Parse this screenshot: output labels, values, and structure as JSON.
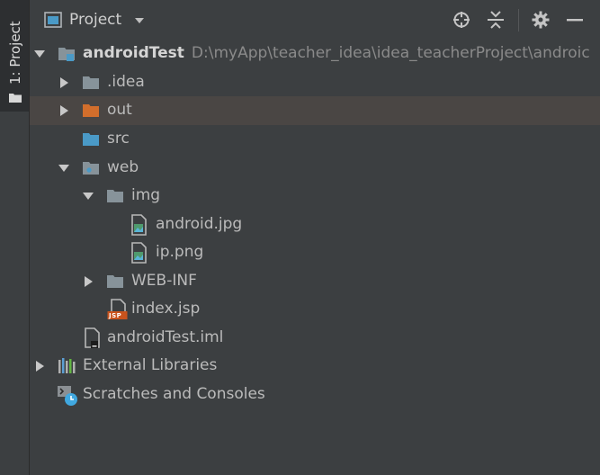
{
  "sidebar": {
    "tab_label": "1: Project"
  },
  "header": {
    "title": "Project",
    "buttons": [
      "locate-icon",
      "collapse-all-icon",
      "gear-icon",
      "minimize-icon"
    ]
  },
  "tree": {
    "root": {
      "name": "androidTest",
      "path": "D:\\myApp\\teacher_idea\\idea_teacherProject\\androic"
    },
    "items": [
      {
        "label": ".idea",
        "type": "folder",
        "expanded": false
      },
      {
        "label": "out",
        "type": "excluded-folder",
        "expanded": false,
        "selected": true
      },
      {
        "label": "src",
        "type": "source-folder"
      },
      {
        "label": "web",
        "type": "web-folder",
        "expanded": true
      },
      {
        "label": "img",
        "type": "folder",
        "expanded": true
      },
      {
        "label": "android.jpg",
        "type": "image-file"
      },
      {
        "label": "ip.png",
        "type": "image-file"
      },
      {
        "label": "WEB-INF",
        "type": "folder",
        "expanded": false
      },
      {
        "label": "index.jsp",
        "type": "jsp-file",
        "badge": "JSP"
      },
      {
        "label": "androidTest.iml",
        "type": "module-file"
      },
      {
        "label": "External Libraries",
        "type": "libraries",
        "expanded": false
      },
      {
        "label": "Scratches and Consoles",
        "type": "scratches"
      }
    ]
  },
  "colors": {
    "folder": "#87939a",
    "excluded_folder": "#d26e2c",
    "source_folder": "#4a9ac7",
    "selected_row": "#4a4644"
  }
}
